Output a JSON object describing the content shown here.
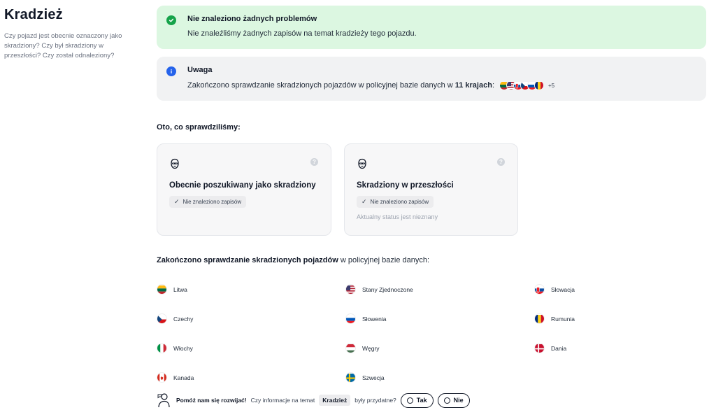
{
  "sidebar": {
    "title": "Kradzież",
    "description": "Czy pojazd jest obecnie oznaczony jako skradziony? Czy był skradziony w przeszłości? Czy został odnaleziony?"
  },
  "success_alert": {
    "title": "Nie znaleziono żadnych problemów",
    "message": "Nie znaleźliśmy żadnych zapisów na temat kradzieży tego pojazdu.",
    "icon": "check-circle-icon",
    "color": "#16a34a"
  },
  "info_alert": {
    "title": "Uwaga",
    "message_before": "Zakończono sprawdzanie skradzionych pojazdów w policyjnej bazie danych w",
    "message_bold": "11 krajach",
    "message_after": ":",
    "more_count": "+5",
    "icon": "info-icon",
    "color": "#2563eb"
  },
  "checked_title": "Oto, co sprawdziliśmy:",
  "cards": [
    {
      "title": "Obecnie poszukiwany jako skradziony",
      "chip": "Nie znaleziono zapisów",
      "note": ""
    },
    {
      "title": "Skradziony w przeszłości",
      "chip": "Nie znaleziono zapisów",
      "note": "Aktualny status jest nieznany"
    }
  ],
  "db": {
    "title_bold": "Zakończono sprawdzanie skradzionych pojazdów",
    "title_rest": " w policyjnej bazie danych:"
  },
  "countries": [
    {
      "name": "Litwa"
    },
    {
      "name": "Stany Zjednoczone"
    },
    {
      "name": "Słowacja"
    },
    {
      "name": "Czechy"
    },
    {
      "name": "Słowenia"
    },
    {
      "name": "Rumunia"
    },
    {
      "name": "Włochy"
    },
    {
      "name": "Węgry"
    },
    {
      "name": "Dania"
    },
    {
      "name": "Kanada"
    },
    {
      "name": "Szwecja"
    }
  ],
  "feedback": {
    "help_text": "Pomóż nam się rozwijać!",
    "question_before": "Czy informacje na temat",
    "topic": "Kradzież",
    "question_after": "były przydatne?",
    "yes_label": "Tak",
    "no_label": "Nie"
  }
}
